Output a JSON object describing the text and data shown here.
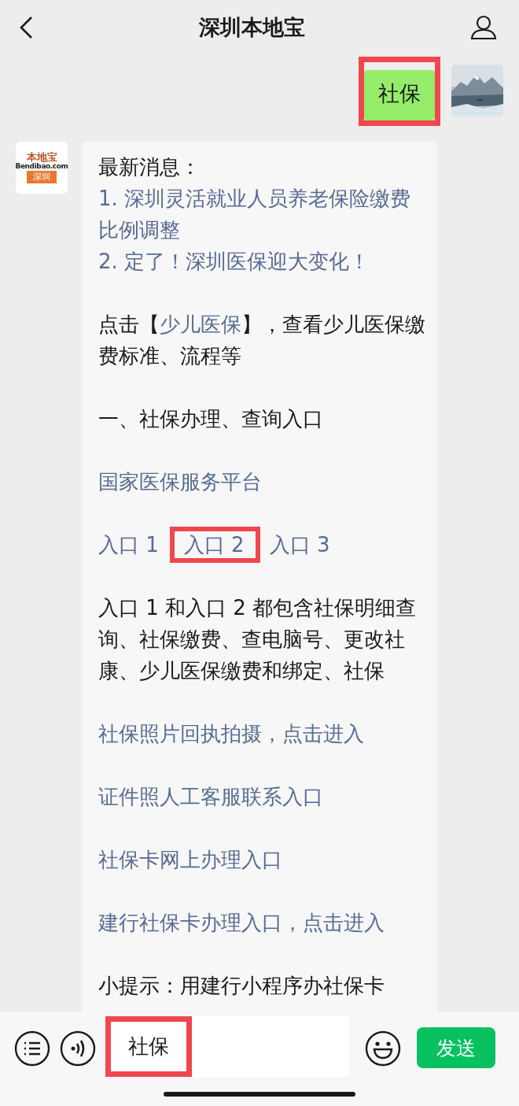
{
  "header": {
    "title": "深圳本地宝"
  },
  "messages": [
    {
      "kind": "text",
      "text": "社保",
      "highlighted": true
    },
    {
      "kind": "rich",
      "avatar": {
        "logo": "本地宝",
        "logo_sub": "Bendibao.com",
        "logo_city": "深圳"
      },
      "blocks": [
        {
          "kind": "text",
          "text": "最新消息："
        },
        {
          "kind": "link",
          "text": "1. 深圳灵活就业人员养老保险缴费比例调整"
        },
        {
          "kind": "link",
          "text": "2. 定了！深圳医保迎大变化！"
        },
        {
          "kind": "blank"
        },
        {
          "kind": "mixed",
          "parts": [
            {
              "text": "点击【",
              "link": false
            },
            {
              "text": "少儿医保",
              "link": true
            },
            {
              "text": "】，查看少儿医保缴费标准、流程等",
              "link": false
            }
          ]
        },
        {
          "kind": "blank"
        },
        {
          "kind": "text",
          "text": "一、社保办理、查询入口"
        },
        {
          "kind": "blank"
        },
        {
          "kind": "link",
          "text": "国家医保服务平台"
        },
        {
          "kind": "blank"
        },
        {
          "kind": "links",
          "items": [
            {
              "text": "入口 1",
              "highlighted": false
            },
            {
              "text": "入口 2",
              "highlighted": true
            },
            {
              "text": "入口 3",
              "highlighted": false
            }
          ]
        },
        {
          "kind": "blank"
        },
        {
          "kind": "text",
          "text": "入口 1 和入口 2 都包含社保明细查询、社保缴费、查电脑号、更改社康、少儿医保缴费和绑定、社保"
        },
        {
          "kind": "blank"
        },
        {
          "kind": "link",
          "text": "社保照片回执拍摄，点击进入"
        },
        {
          "kind": "blank"
        },
        {
          "kind": "link",
          "text": "证件照人工客服联系入口"
        },
        {
          "kind": "blank"
        },
        {
          "kind": "link",
          "text": "社保卡网上办理入口"
        },
        {
          "kind": "blank"
        },
        {
          "kind": "link",
          "text": "建行社保卡办理入口，点击进入"
        },
        {
          "kind": "blank"
        },
        {
          "kind": "text",
          "text": "小提示：用建行小程序办社保卡"
        }
      ]
    }
  ],
  "input": {
    "value": "社保",
    "highlighted": true
  },
  "send_button": "发送"
}
